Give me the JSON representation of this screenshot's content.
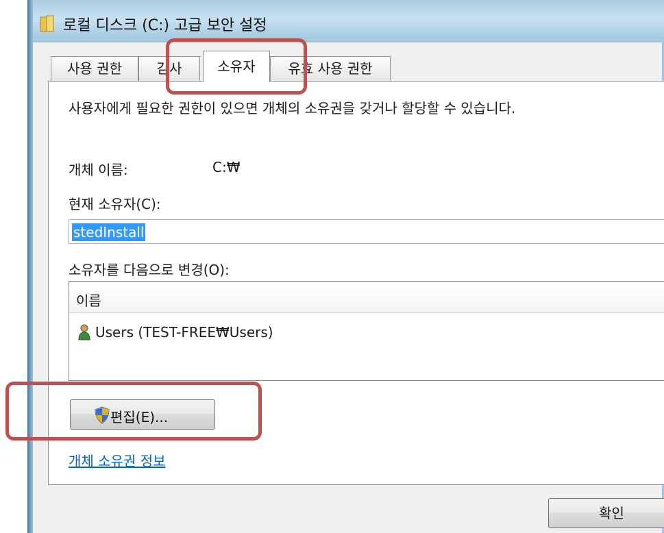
{
  "window": {
    "title": "로컬 디스크 (C:) 고급 보안 설정",
    "icon": "folder-icon"
  },
  "tabs": [
    {
      "label": "사용 권한",
      "active": false
    },
    {
      "label": "감사",
      "active": false
    },
    {
      "label": "소유자",
      "active": true
    },
    {
      "label": "유효 사용 권한",
      "active": false
    }
  ],
  "owner_tab": {
    "description": "사용자에게 필요한 권한이 있으면 개체의 소유권을 갖거나 할당할 수 있습니다.",
    "object_name_label": "개체 이름:",
    "object_name_value": "C:₩",
    "current_owner_label": "현재 소유자(C):",
    "current_owner_value": "stedInstall",
    "change_owner_label": "소유자를 다음으로 변경(O):",
    "list_header": "이름",
    "list_items": [
      {
        "label": "Users (TEST-FREE₩Users)",
        "icon": "user-icon"
      }
    ],
    "edit_button": "편집(E)...",
    "edit_button_icon": "uac-shield-icon",
    "ownership_link": "개체 소유권 정보"
  },
  "footer": {
    "ok_button": "확인"
  },
  "colors": {
    "annotation": "#c0504d",
    "selection": "#3399ff",
    "link": "#0066cc",
    "titlebar": "#b3d4e8"
  }
}
